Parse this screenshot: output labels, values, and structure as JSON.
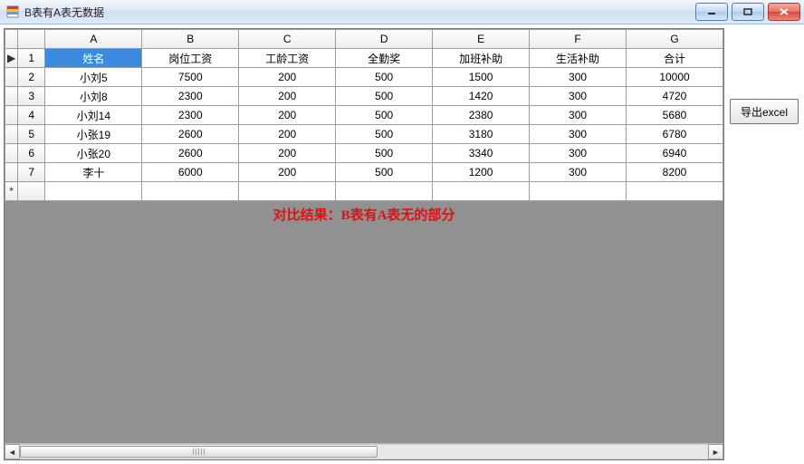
{
  "window": {
    "title": "B表有A表无数据"
  },
  "grid": {
    "col_letters": [
      "A",
      "B",
      "C",
      "D",
      "E",
      "F",
      "G"
    ],
    "row_numbers": [
      "1",
      "2",
      "3",
      "4",
      "5",
      "6",
      "7"
    ],
    "header_row": [
      "姓名",
      "岗位工资",
      "工龄工资",
      "全勤奖",
      "加班补助",
      "生活补助",
      "合计"
    ],
    "rows": [
      [
        "小刘5",
        "7500",
        "200",
        "500",
        "1500",
        "300",
        "10000"
      ],
      [
        "小刘8",
        "2300",
        "200",
        "500",
        "1420",
        "300",
        "4720"
      ],
      [
        "小刘14",
        "2300",
        "200",
        "500",
        "2380",
        "300",
        "5680"
      ],
      [
        "小张19",
        "2600",
        "200",
        "500",
        "3180",
        "300",
        "6780"
      ],
      [
        "小张20",
        "2600",
        "200",
        "500",
        "3340",
        "300",
        "6940"
      ],
      [
        "李十",
        "6000",
        "200",
        "500",
        "1200",
        "300",
        "8200"
      ]
    ],
    "selected_cell": {
      "row": 0,
      "col": 0
    },
    "new_row_indicator": "*",
    "current_row_indicator": "▶"
  },
  "result_banner": "对比结果：B表有A表无的部分",
  "buttons": {
    "export_label": "导出excel"
  }
}
